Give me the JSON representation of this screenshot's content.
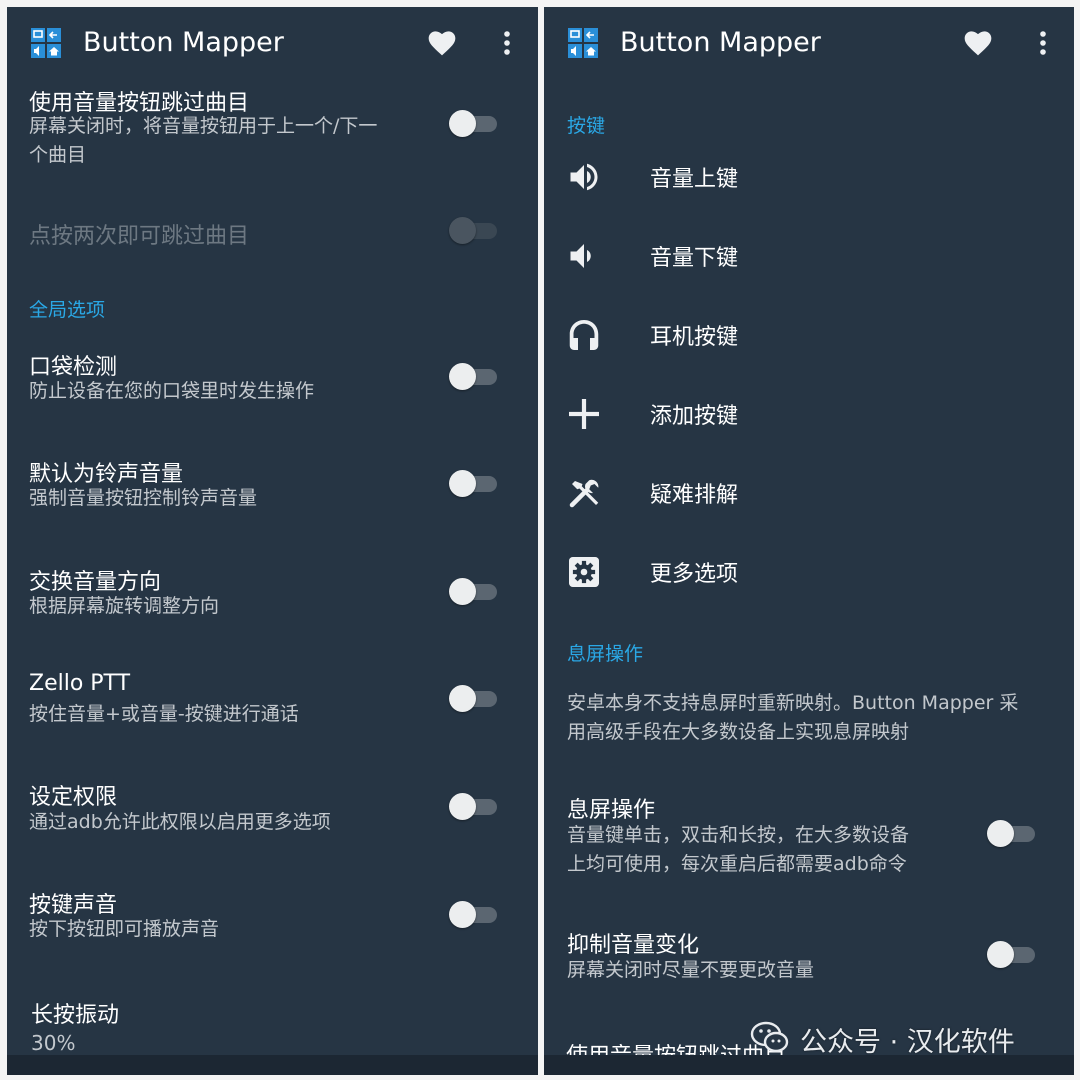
{
  "app": {
    "title": "Button Mapper"
  },
  "left": {
    "items": [
      {
        "title": "使用音量按钮跳过曲目",
        "subtitle": [
          "屏幕关闭时，将音量按钮用于上一个/下一",
          "个曲目"
        ]
      },
      {
        "title": "点按两次即可跳过曲目"
      }
    ],
    "section_global": "全局选项",
    "global_items": [
      {
        "title": "口袋检测",
        "subtitle": "防止设备在您的口袋里时发生操作"
      },
      {
        "title": "默认为铃声音量",
        "subtitle": "强制音量按钮控制铃声音量"
      },
      {
        "title": "交换音量方向",
        "subtitle": "根据屏幕旋转调整方向"
      },
      {
        "title": "Zello PTT",
        "subtitle": "按住音量+或音量-按键进行通话"
      },
      {
        "title": "设定权限",
        "subtitle": "通过adb允许此权限以启用更多选项"
      },
      {
        "title": "按键声音",
        "subtitle": "按下按钮即可播放声音"
      }
    ],
    "long_press": {
      "title": "长按振动",
      "value": "30%"
    }
  },
  "right": {
    "section_keys": "按键",
    "keys": [
      {
        "label": "音量上键",
        "icon": "volume-up-icon"
      },
      {
        "label": "音量下键",
        "icon": "volume-down-icon"
      },
      {
        "label": "耳机按键",
        "icon": "headphones-icon"
      },
      {
        "label": "添加按键",
        "icon": "plus-icon"
      },
      {
        "label": "疑难排解",
        "icon": "tools-icon"
      },
      {
        "label": "更多选项",
        "icon": "gear-icon"
      }
    ],
    "section_screen_off": "息屏操作",
    "screen_off_desc": [
      "安卓本身不支持息屏时重新映射。Button Mapper 采",
      "用高级手段在大多数设备上实现息屏映射"
    ],
    "items": [
      {
        "title": "息屏操作",
        "subtitle": [
          "音量键单击，双击和长按，在大多数设备",
          "上均可使用，每次重启后都需要adb命令"
        ]
      },
      {
        "title": "抑制音量变化",
        "subtitle": [
          "屏幕关闭时尽量不要更改音量"
        ]
      }
    ],
    "clipped_item": "使用音量按钮跳过曲目"
  },
  "toggles": {
    "all_off": true
  },
  "watermark": {
    "text": "公众号 · 汉化软件"
  },
  "colors": {
    "background": "#263544",
    "accent": "#2aa8e6",
    "subtitle": "#c3c8cd"
  }
}
